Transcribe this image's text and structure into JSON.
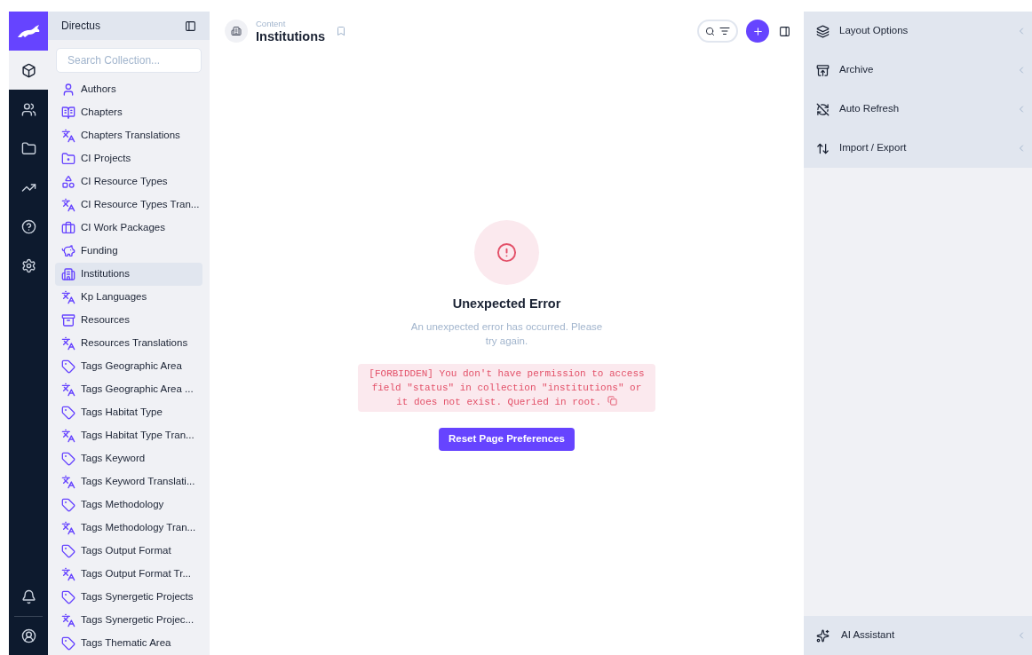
{
  "rail": {
    "modules": [
      {
        "kind": "content",
        "selected": true
      },
      {
        "kind": "users",
        "selected": false
      },
      {
        "kind": "files",
        "selected": false
      },
      {
        "kind": "insights",
        "selected": false
      },
      {
        "kind": "help",
        "selected": false
      },
      {
        "kind": "settings",
        "selected": false
      }
    ],
    "bottom": [
      {
        "kind": "notifications"
      },
      {
        "kind": "account"
      }
    ]
  },
  "nav": {
    "title": "Directus",
    "search": {
      "placeholder": "Search Collection..."
    },
    "items": [
      {
        "label": "Authors",
        "kind": "person",
        "selected": false
      },
      {
        "label": "Chapters",
        "kind": "book",
        "selected": false
      },
      {
        "label": "Chapters Translations",
        "kind": "translation",
        "selected": false
      },
      {
        "label": "CI Projects",
        "kind": "folder",
        "selected": false
      },
      {
        "label": "CI Resource Types",
        "kind": "shapes",
        "selected": false
      },
      {
        "label": "CI Resource Types Tran...",
        "kind": "translation",
        "selected": false
      },
      {
        "label": "CI Work Packages",
        "kind": "briefcase",
        "selected": false
      },
      {
        "label": "Funding",
        "kind": "piggy-bank",
        "selected": false
      },
      {
        "label": "Institutions",
        "kind": "building",
        "selected": true
      },
      {
        "label": "Kp Languages",
        "kind": "translation",
        "selected": false
      },
      {
        "label": "Resources",
        "kind": "archive",
        "selected": false
      },
      {
        "label": "Resources Translations",
        "kind": "translation",
        "selected": false
      },
      {
        "label": "Tags Geographic Area",
        "kind": "tag",
        "selected": false
      },
      {
        "label": "Tags Geographic Area ...",
        "kind": "translation",
        "selected": false
      },
      {
        "label": "Tags Habitat Type",
        "kind": "tag",
        "selected": false
      },
      {
        "label": "Tags Habitat Type Tran...",
        "kind": "translation",
        "selected": false
      },
      {
        "label": "Tags Keyword",
        "kind": "tag",
        "selected": false
      },
      {
        "label": "Tags Keyword Translati...",
        "kind": "translation",
        "selected": false
      },
      {
        "label": "Tags Methodology",
        "kind": "tag",
        "selected": false
      },
      {
        "label": "Tags Methodology Tran...",
        "kind": "translation",
        "selected": false
      },
      {
        "label": "Tags Output Format",
        "kind": "tag",
        "selected": false
      },
      {
        "label": "Tags Output Format Tr...",
        "kind": "translation",
        "selected": false
      },
      {
        "label": "Tags Synergetic Projects",
        "kind": "tag",
        "selected": false
      },
      {
        "label": "Tags Synergetic Projec...",
        "kind": "translation",
        "selected": false
      },
      {
        "label": "Tags Thematic Area",
        "kind": "tag",
        "selected": false
      }
    ]
  },
  "header": {
    "breadcrumb": "Content",
    "title": "Institutions"
  },
  "error": {
    "title": "Unexpected Error",
    "message": "An unexpected error has occurred. Please try again.",
    "details": "[FORBIDDEN] You don't have permission to access field \"status\" in collection \"institutions\" or it does not exist. Queried in root.",
    "button": "Reset Page Preferences"
  },
  "sidebar": {
    "items": [
      {
        "label": "Layout Options",
        "kind": "layers"
      },
      {
        "label": "Archive",
        "kind": "archive"
      },
      {
        "label": "Auto Refresh",
        "kind": "refresh-off"
      },
      {
        "label": "Import / Export",
        "kind": "import-export"
      }
    ],
    "assistant": {
      "label": "AI Assistant"
    }
  }
}
